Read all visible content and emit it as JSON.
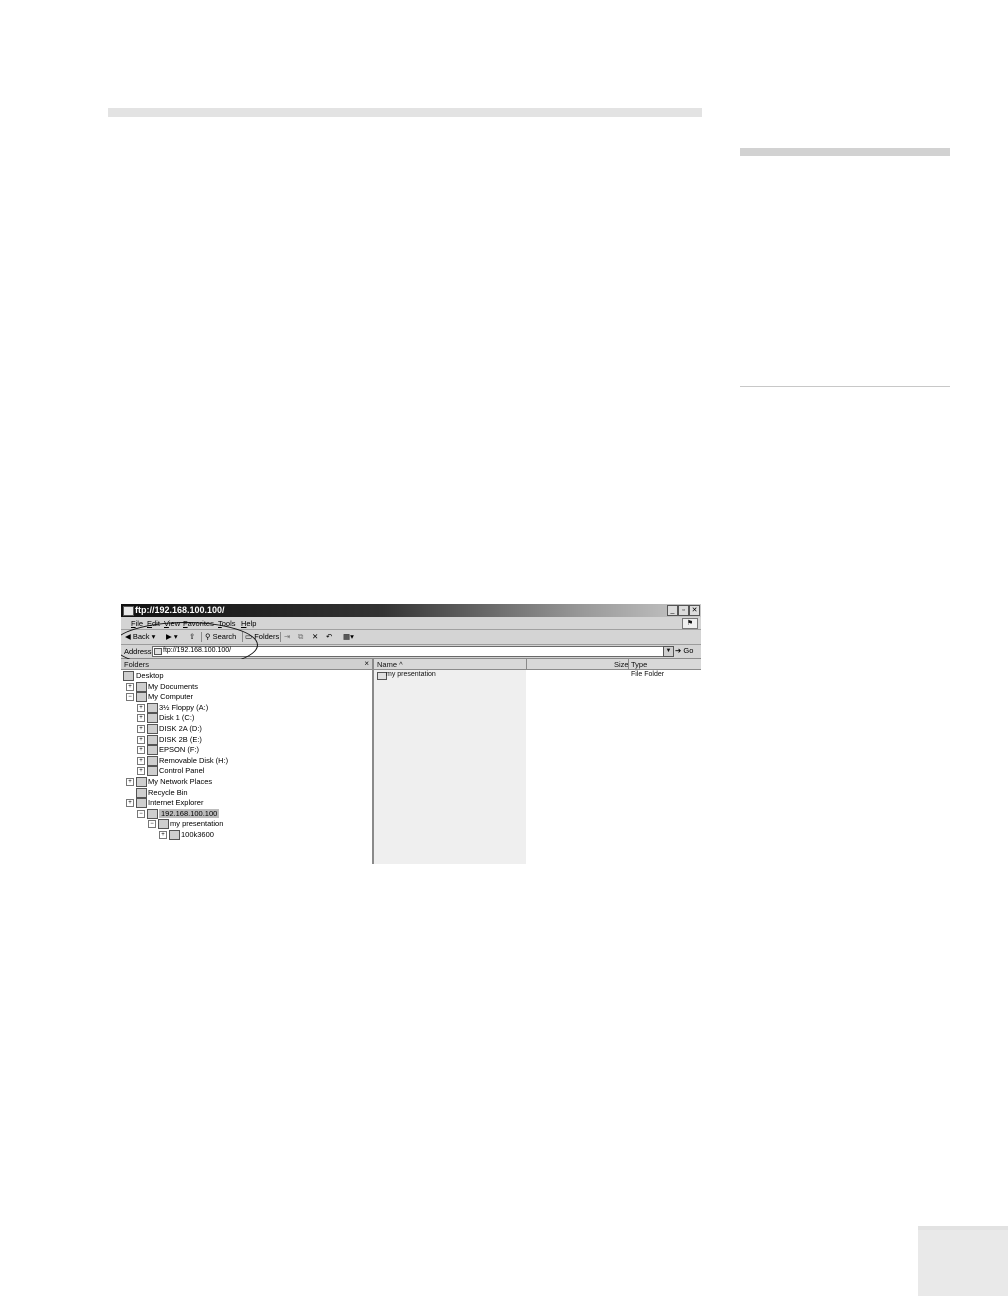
{
  "window": {
    "title": "ftp://192.168.100.100/",
    "controls": [
      "_",
      "▫",
      "✕"
    ]
  },
  "menu": {
    "items": [
      "File",
      "Edit",
      "View",
      "Favorites",
      "Tools",
      "Help"
    ]
  },
  "toolbar": {
    "back_label": "Back",
    "search_label": "Search",
    "folders_label": "Folders"
  },
  "address": {
    "label": "Address",
    "value": "ftp://192.168.100.100/",
    "go_label": "Go"
  },
  "folders_pane": {
    "title": "Folders",
    "close": "×",
    "tree": [
      {
        "label": "Desktop",
        "level": 0,
        "expander": ""
      },
      {
        "label": "My Documents",
        "level": 1,
        "expander": "+"
      },
      {
        "label": "My Computer",
        "level": 1,
        "expander": "−"
      },
      {
        "label": "3½ Floppy (A:)",
        "level": 2,
        "expander": "+"
      },
      {
        "label": "Disk 1 (C:)",
        "level": 2,
        "expander": "+"
      },
      {
        "label": "DISK 2A (D:)",
        "level": 2,
        "expander": "+"
      },
      {
        "label": "DISK 2B (E:)",
        "level": 2,
        "expander": "+"
      },
      {
        "label": "EPSON (F:)",
        "level": 2,
        "expander": "+"
      },
      {
        "label": "Removable Disk (H:)",
        "level": 2,
        "expander": "+"
      },
      {
        "label": "Control Panel",
        "level": 2,
        "expander": "+"
      },
      {
        "label": "My Network Places",
        "level": 1,
        "expander": "+"
      },
      {
        "label": "Recycle Bin",
        "level": 1,
        "expander": ""
      },
      {
        "label": "Internet Explorer",
        "level": 1,
        "expander": "+"
      },
      {
        "label": "192.168.100.100",
        "level": 2,
        "expander": "−",
        "selected": true
      },
      {
        "label": "my presentation",
        "level": 3,
        "expander": "−"
      },
      {
        "label": "100k3600",
        "level": 4,
        "expander": "+"
      }
    ]
  },
  "file_list": {
    "columns": {
      "name": "Name",
      "sort_indicator": "^",
      "size": "Size",
      "type": "Type"
    },
    "rows": [
      {
        "name": "my presentation",
        "size": "",
        "type": "File Folder"
      }
    ]
  }
}
